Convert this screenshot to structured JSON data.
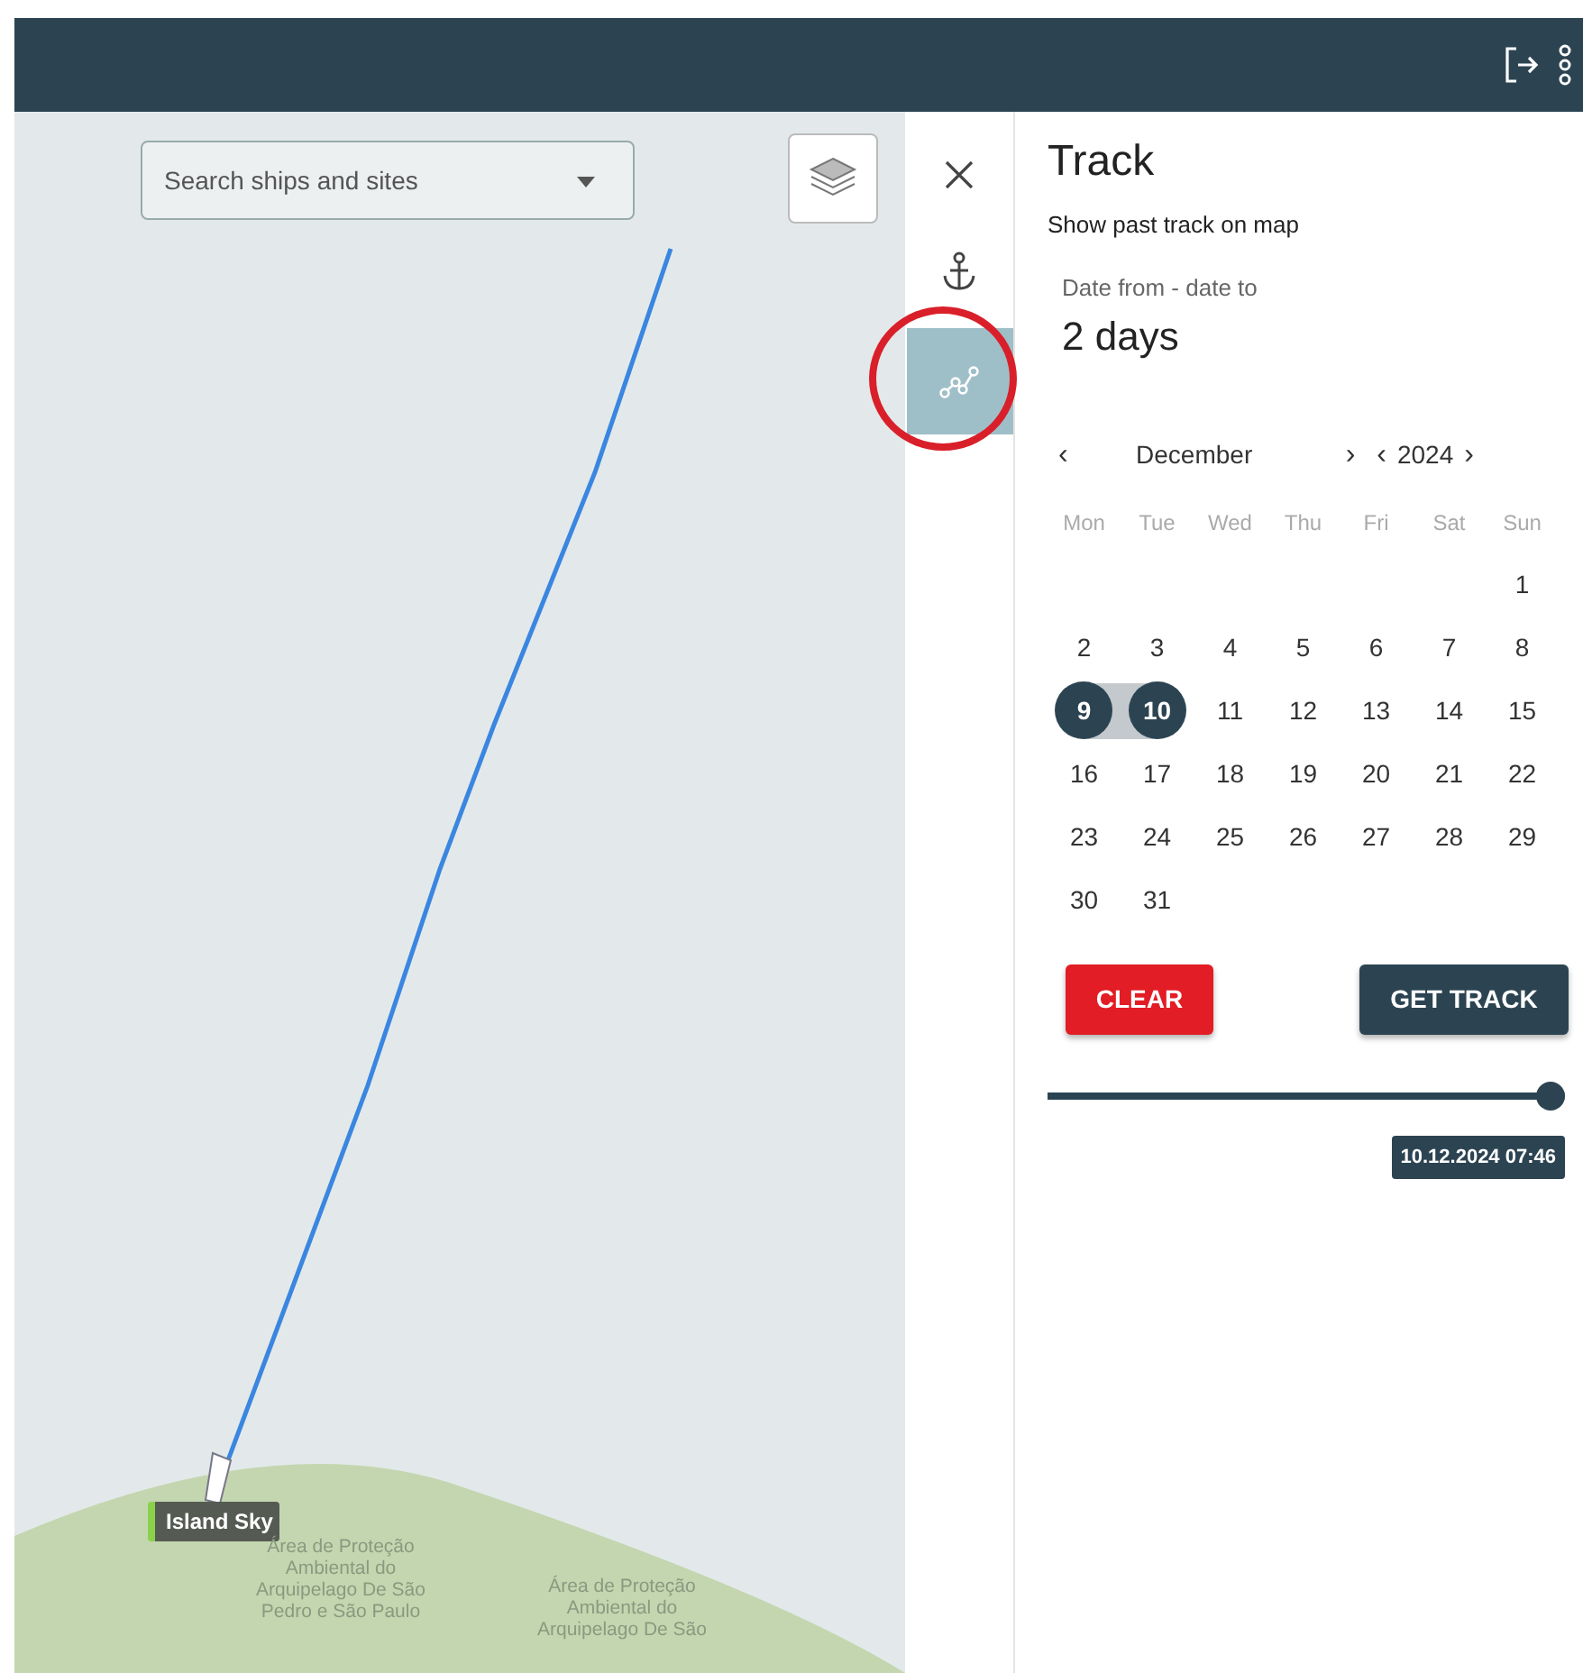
{
  "map": {
    "search": {
      "placeholder": "Search ships and sites"
    },
    "ship_label": "Island Sky",
    "area_labels": [
      "Área de Proteção Ambiental do Arquipelago De São Pedro e São Paulo",
      "Área de Proteção Ambiental do Arquipelago De São"
    ]
  },
  "side_tools": [
    {
      "kind": "close",
      "selected": false
    },
    {
      "kind": "anchor",
      "selected": false
    },
    {
      "kind": "track",
      "selected": true
    }
  ],
  "panel": {
    "title": "Track",
    "subtitle": "Show past track on map",
    "range_label": "Date from - date to",
    "range_value": "2 days",
    "calendar": {
      "prev_month": "‹",
      "month": "December",
      "next_month": "›",
      "prev_year": "‹",
      "year": "2024",
      "next_year": "›",
      "weekdays": [
        "Mon",
        "Tue",
        "Wed",
        "Thu",
        "Fri",
        "Sat",
        "Sun"
      ],
      "weeks": [
        [
          {
            "day": "1",
            "selected": false
          }
        ],
        [
          {
            "day": "2",
            "selected": false
          },
          {
            "day": "3",
            "selected": false
          },
          {
            "day": "4",
            "selected": false
          },
          {
            "day": "5",
            "selected": false
          },
          {
            "day": "6",
            "selected": false
          },
          {
            "day": "7",
            "selected": false
          },
          {
            "day": "8",
            "selected": false
          }
        ],
        [
          {
            "day": "9",
            "selected": true
          },
          {
            "day": "10",
            "selected": true
          },
          {
            "day": "11",
            "selected": false
          },
          {
            "day": "12",
            "selected": false
          },
          {
            "day": "13",
            "selected": false
          },
          {
            "day": "14",
            "selected": false
          },
          {
            "day": "15",
            "selected": false
          }
        ],
        [
          {
            "day": "16",
            "selected": false
          },
          {
            "day": "17",
            "selected": false
          },
          {
            "day": "18",
            "selected": false
          },
          {
            "day": "19",
            "selected": false
          },
          {
            "day": "20",
            "selected": false
          },
          {
            "day": "21",
            "selected": false
          },
          {
            "day": "22",
            "selected": false
          }
        ],
        [
          {
            "day": "23",
            "selected": false
          },
          {
            "day": "24",
            "selected": false
          },
          {
            "day": "25",
            "selected": false
          },
          {
            "day": "26",
            "selected": false
          },
          {
            "day": "27",
            "selected": false
          },
          {
            "day": "28",
            "selected": false
          },
          {
            "day": "29",
            "selected": false
          }
        ],
        [
          {
            "day": "30",
            "selected": false
          },
          {
            "day": "31",
            "selected": false
          }
        ]
      ]
    },
    "buttons": {
      "clear": "CLEAR",
      "get_track": "GET TRACK"
    },
    "slider": {
      "level": 1,
      "tooltip": "10.12.2024 07:46"
    }
  }
}
